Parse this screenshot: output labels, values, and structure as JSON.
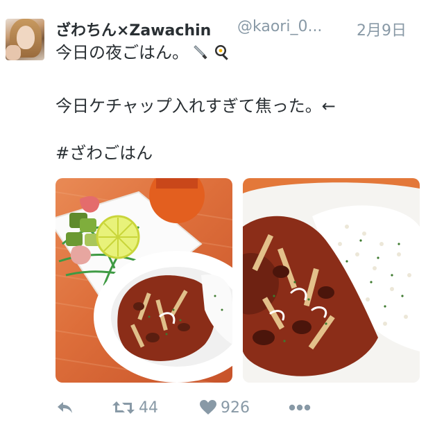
{
  "tweet": {
    "display_name": "ざわちん×Zawachin",
    "handle": "@kaori_0...",
    "timestamp": "2月9日",
    "line1": "今日の夜ごはん。",
    "line1_emoji": [
      "knife-icon",
      "frying-pan-egg-icon"
    ],
    "line2": "今日ケチャップ入れすぎて焦った。←",
    "line3": "#ざわごはん",
    "photos": [
      {
        "subject": "salad-and-stew-plate"
      },
      {
        "subject": "stew-with-rice-closeup"
      }
    ]
  },
  "actions": {
    "reply_icon": "reply-icon",
    "retweet_icon": "retweet-icon",
    "retweet_count": "44",
    "like_icon": "heart-icon",
    "like_count": "926",
    "more_icon": "more-icon"
  },
  "colors": {
    "text": "#292f33",
    "muted": "#8899a6",
    "plate_orange": "#dd6e3a",
    "stew": "#8b2d18"
  }
}
